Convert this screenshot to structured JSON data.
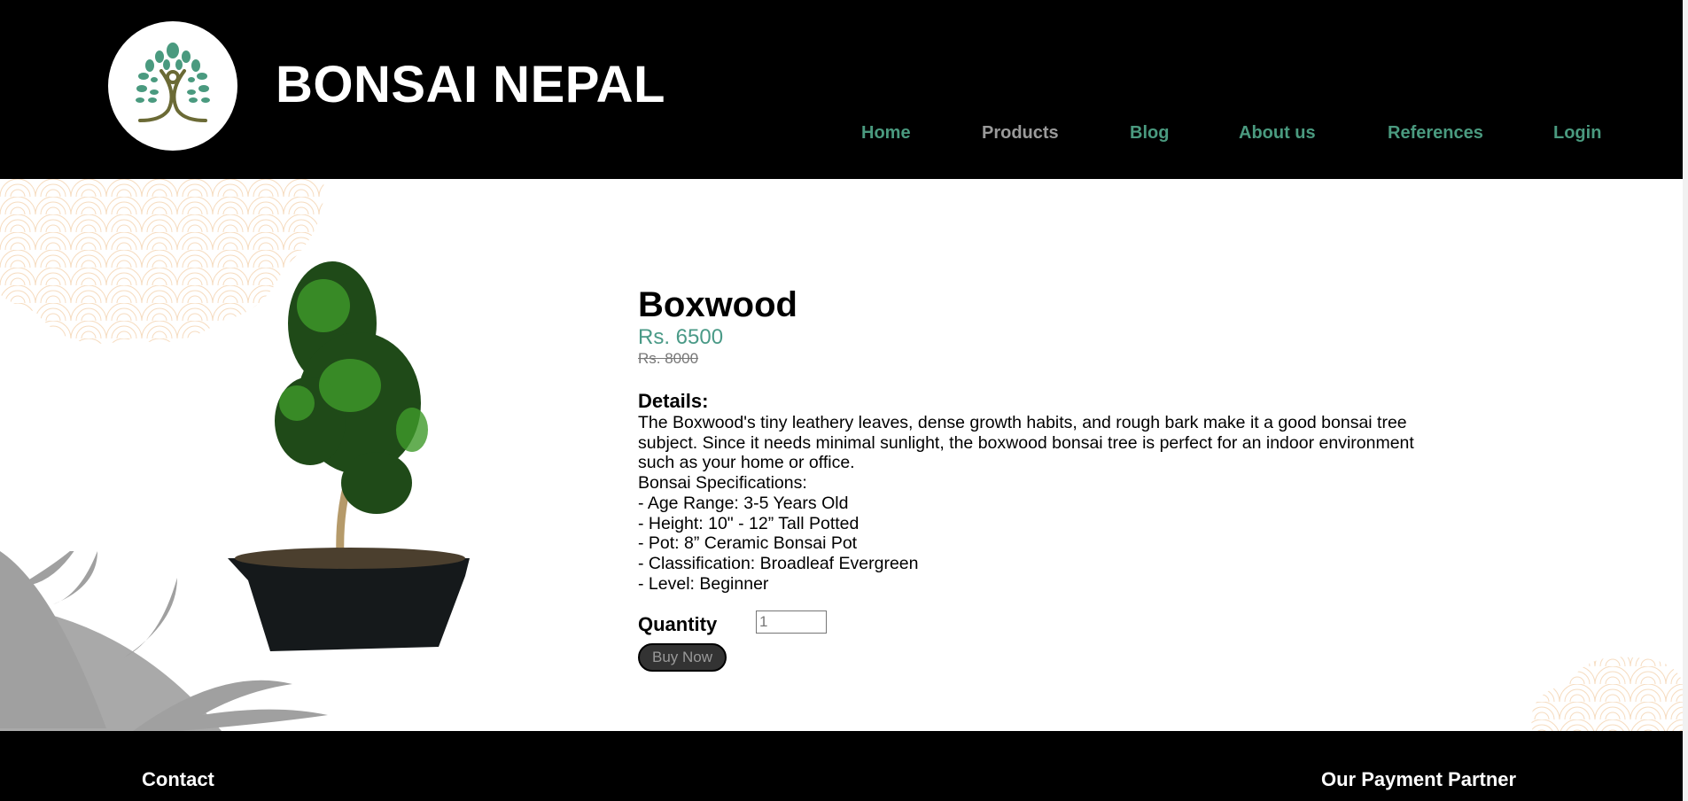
{
  "header": {
    "brand": "BONSAI NEPAL",
    "nav": [
      {
        "label": "Home"
      },
      {
        "label": "Products",
        "active": true
      },
      {
        "label": "Blog"
      },
      {
        "label": "About us"
      },
      {
        "label": "References"
      },
      {
        "label": "Login"
      }
    ]
  },
  "product": {
    "title": "Boxwood",
    "price": "Rs. 6500",
    "old_price": "Rs. 8000",
    "details_heading": "Details:",
    "details": [
      "The Boxwood's tiny leathery leaves, dense growth habits, and rough bark make it a good bonsai tree",
      "subject. Since it needs minimal sunlight, the boxwood bonsai tree is perfect for an indoor environment",
      "such as your home or office.",
      "Bonsai Specifications:",
      "- Age Range: 3-5 Years Old",
      "- Height: 10\" - 12” Tall Potted",
      "- Pot: 8” Ceramic Bonsai Pot",
      "- Classification: Broadleaf Evergreen",
      "- Level: Beginner"
    ],
    "quantity_label": "Quantity",
    "quantity_value": "1",
    "buy_label": "Buy Now"
  },
  "footer": {
    "contact": "Contact",
    "payment": "Our Payment Partner"
  },
  "colors": {
    "accent": "#4a9a7f",
    "header_bg": "#000000",
    "muted_nav": "#9a9a9a"
  }
}
